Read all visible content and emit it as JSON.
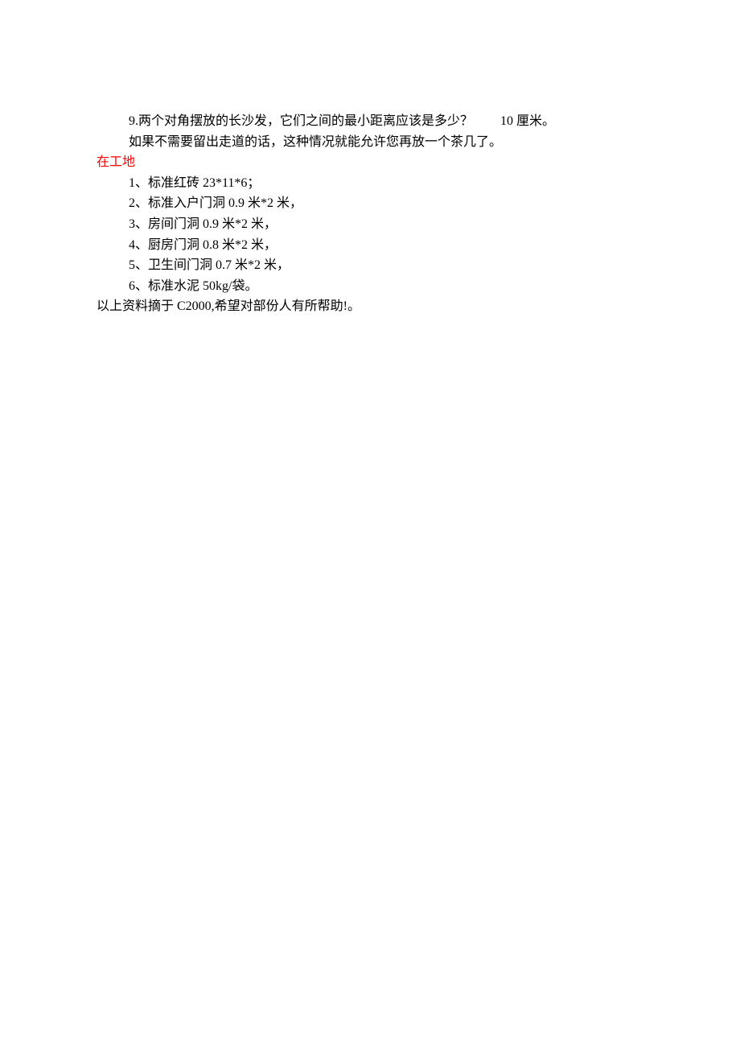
{
  "lines": {
    "q9": "9.两个对角摆放的长沙发，它们之间的最小距离应该是多少？",
    "q9_ans": "10 厘米。",
    "q9_note": "如果不需要留出走道的话，这种情况就能允许您再放一个茶几了。",
    "section": "在工地",
    "items": [
      "1、标准红砖 23*11*6；",
      "2、标准入户门洞 0.9 米*2 米，",
      "3、房间门洞 0.9 米*2 米，",
      "4、厨房门洞 0.8 米*2 米，",
      "5、卫生间门洞 0.7 米*2 米，",
      "6、标准水泥 50kg/袋。"
    ],
    "footer": "以上资料摘于 C2000,希望对部份人有所帮助!。"
  }
}
